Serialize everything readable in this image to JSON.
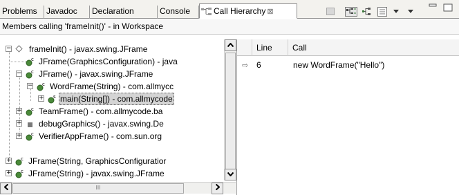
{
  "tabs": [
    {
      "label": "Problems"
    },
    {
      "label": "Javadoc"
    },
    {
      "label": "Declaration"
    },
    {
      "label": "Console"
    },
    {
      "label": "Call Hierarchy",
      "close": "⊠"
    }
  ],
  "header": {
    "text": "Members calling 'frameInit()' - in Workspace"
  },
  "tree": {
    "root": "frameInit() - javax.swing.JFrame",
    "items": [
      {
        "label": "JFrame(GraphicsConfiguration) - java"
      },
      {
        "label": "JFrame() - javax.swing.JFrame"
      },
      {
        "label": "WordFrame(String) - com.allmycc"
      },
      {
        "label": "main(String[]) - com.allmycode"
      },
      {
        "label": "TeamFrame() - com.allmycode.ba"
      },
      {
        "label": "debugGraphics() - javax.swing.De"
      },
      {
        "label": "VerifierAppFrame() - com.sun.org"
      },
      {
        "label": "JFrame(String, GraphicsConfiguratior"
      },
      {
        "label": "JFrame(String) - javax.swing.JFrame"
      }
    ]
  },
  "table": {
    "columns": [
      "Line",
      "Call"
    ],
    "rows": [
      {
        "line": "6",
        "call": "new WordFrame(\"Hello\")"
      }
    ]
  },
  "scrollbar": {
    "h_grip": "III"
  },
  "colors": {
    "selection": "#d4d4d4",
    "method_green": "#4a8a3a",
    "tab_border": "#8c8c8c"
  }
}
